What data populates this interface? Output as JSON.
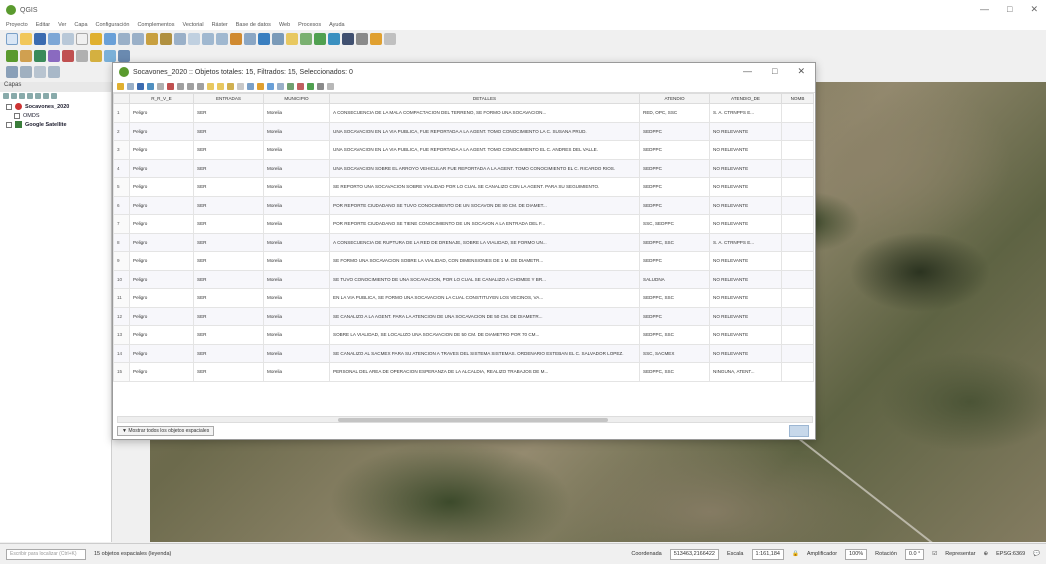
{
  "app": {
    "title": "QGIS",
    "window_controls": [
      "—",
      "□",
      "✕"
    ],
    "menus": [
      "Proyecto",
      "Editar",
      "Ver",
      "Capa",
      "Configuración",
      "Complementos",
      "Vectorial",
      "Ráster",
      "Base de datos",
      "Web",
      "Procesos",
      "Ayuda"
    ]
  },
  "layers_panel": {
    "header": "Capas",
    "layers": [
      {
        "name": "Socavones_2020",
        "checked": true,
        "color": "#cc3333"
      },
      {
        "name": "OMDS",
        "checked": false,
        "color": "#888888"
      },
      {
        "name": "Google Satellite",
        "checked": true,
        "color": "#3a7d3a"
      }
    ]
  },
  "dialog": {
    "title": "Socavones_2020 :: Objetos totales: 15, Filtrados: 15, Seleccionados: 0",
    "columns": [
      "R_R_V_E",
      "ENTRADAS",
      "MUNICIPIO",
      "DETALLES",
      "ATENDIO",
      "ATENDIO_DE",
      "NOMB"
    ],
    "rows": [
      [
        "1",
        "Peligro",
        "SER",
        "Morelia",
        "A CONSECUENCIA DE LA MALA COMPACTACION DEL TERRENO, SE FORMO UNA SOCAVACION...",
        "RED, OPC, SSC",
        "S. A. CTRNPPS E..."
      ],
      [
        "2",
        "Peligro",
        "SER",
        "Morelia",
        "UNA SOCAVACION EN LA VIA PUBLICA, FUE REPORTADA A LA AGENT. TOMO CONOCIMIENTO LA C. SUSANA PRUD.",
        "SEDPPC",
        "NO RELEVANTE"
      ],
      [
        "3",
        "Peligro",
        "SER",
        "Morelia",
        "UNA SOCAVACION EN LA VIA PUBLICA, FUE REPORTADA A LA AGENT. TOMO CONOCIMIENTO EL C. ANDRES DEL VALLE.",
        "SEDPPC",
        "NO RELEVANTE"
      ],
      [
        "4",
        "Peligro",
        "SER",
        "Morelia",
        "UNA SOCAVACION SOBRE EL ARROYO VEHICULAR FUE REPORTADA A LA AGENT. TOMO CONOCIMIENTO EL C. RICARDO RIOS.",
        "SEDPPC",
        "NO RELEVANTE"
      ],
      [
        "5",
        "Peligro",
        "SER",
        "Morelia",
        "SE REPORTO UNA SOCAVACION SOBRE VIALIDAD POR LO CUAL SE CANALIZO CON LA AGENT. PARA SU SEGUIMIENTO.",
        "SEDPPC",
        "NO RELEVANTE"
      ],
      [
        "6",
        "Peligro",
        "SER",
        "Morelia",
        "POR REPORTE CIUDADANO SE TUVO CONOCIMIENTO DE UN SOCAVON DE 80 CM. DE DIAMET...",
        "SEDPPC",
        "NO RELEVANTE"
      ],
      [
        "7",
        "Peligro",
        "SER",
        "Morelia",
        "POR REPORTE CIUDADANO SE TIENE CONOCIMIENTO DE UN SOCAVON A LA ENTRADA DEL F...",
        "SSC, SEDPPC",
        "NO RELEVANTE"
      ],
      [
        "8",
        "Peligro",
        "SER",
        "Morelia",
        "A CONSECUENCIA DE RUPTURA DE LA RED DE DRENAJE, SOBRE LA VIALIDAD, SE FORMO UN...",
        "SEDPPC, SSC",
        "S. A. CTRNPPS E..."
      ],
      [
        "9",
        "Peligro",
        "SER",
        "Morelia",
        "SE FORMO UNA SOCAVACION SOBRE LA VIALIDAD, CON DIMENSIONES DE 1 M. DE DIAMETR...",
        "SEDPPC",
        "NO RELEVANTE"
      ],
      [
        "10",
        "Peligro",
        "SER",
        "Morelia",
        "SE TUVO CONOCIMIENTO DE UNA SOCAVACION, POR LO CUAL SE CANALIZO A CHOMEE Y BR...",
        "SALUDNA",
        "NO RELEVANTE"
      ],
      [
        "11",
        "Peligro",
        "SER",
        "Morelia",
        "EN LA VIA PUBLICA, SE FORMO UNA SOCAVACION LA CUAL CONSTITUYEN LOS VECINOS, VA...",
        "SEDPPC, SSC",
        "NO RELEVANTE"
      ],
      [
        "12",
        "Peligro",
        "SER",
        "Morelia",
        "SE CANALIZO A LA AGENT. PARA LA ATENCION DE UNA SOCAVACION DE 50 CM. DE DIAMETR...",
        "SEDPPC",
        "NO RELEVANTE"
      ],
      [
        "13",
        "Peligro",
        "SER",
        "Morelia",
        "SOBRE LA VIALIDAD, SE LOCALIZO UNA SOCAVACION DE 50 CM. DE DIAMETRO POR 70 CM...",
        "SEDPPC, SSC",
        "NO RELEVANTE"
      ],
      [
        "14",
        "Peligro",
        "SER",
        "Morelia",
        "SE CANALIZO AL SACMEX PARA SU ATENCION A TRAVES DEL SISTEMA SISTEMAS. ORDENARIO ESTEBAN EL C. SALVADOR LOPEZ.",
        "SSC, SACMEX",
        "NO RELEVANTE"
      ],
      [
        "15",
        "Peligro",
        "SER",
        "Morelia",
        "PERSONAL DEL AREA DE OPERACION ESPERANZA DE LA ALCALDIA, REALIZO TRABAJOS DE M...",
        "SEDPPC, SSC",
        "NINGUNA, ATENT..."
      ]
    ],
    "filter_button": "Mostrar todos los objetos espaciales"
  },
  "statusbar": {
    "search_placeholder": "Escribir para localizar (Ctrl+K)",
    "message": "15 objetos espaciales (leyenda)",
    "coordinate_label": "Coordenada",
    "coordinate": "513463,2166422",
    "scale_label": "Escala",
    "scale": "1:161,184",
    "magnifier_label": "Amplificador",
    "magnifier": "100%",
    "rotation_label": "Rotación",
    "rotation": "0.0 °",
    "render_label": "Representar",
    "crs": "EPSG:6369"
  },
  "colors": {
    "accent_green": "#5a9a2e",
    "selection_blue": "#c7d8ea"
  }
}
